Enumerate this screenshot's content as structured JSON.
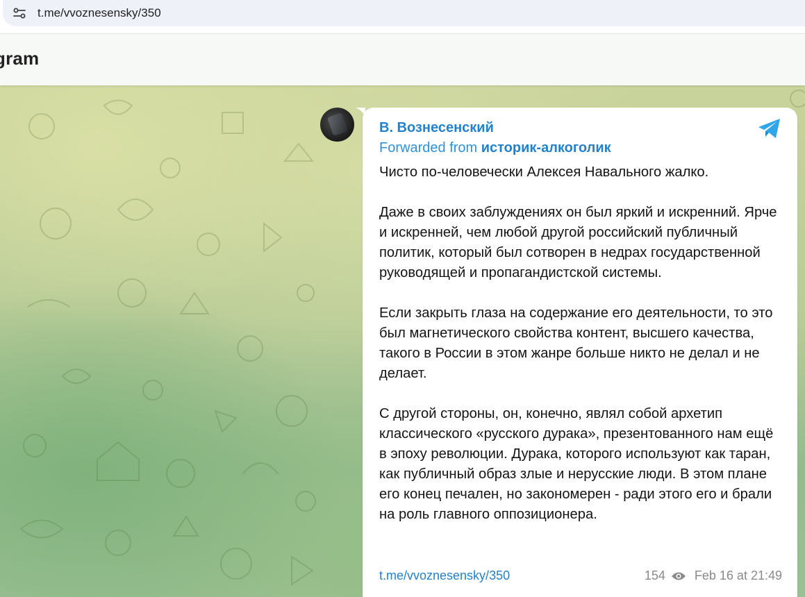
{
  "browser": {
    "url": "t.me/vvoznesensky/350"
  },
  "header": {
    "title": "gram"
  },
  "message": {
    "author": "В. Вознесенский",
    "forwarded_prefix": "Forwarded from ",
    "forwarded_source": "историк-алкоголик",
    "paragraphs": [
      "Чисто по-человечески Алексея Навального жалко.",
      "Даже в своих заблуждениях он был яркий и искренний. Ярче и искренней, чем любой другой российский публичный политик, который был сотворен в недрах государственной руководящей и пропагандистской системы.",
      "Если закрыть глаза на содержание его деятельности, то это был магнетического свойства контент, высшего качества, такого в России в этом жанре больше никто не делал и не делает.",
      "С другой стороны, он, конечно, являл собой архетип классического «русского дурака», презентованного нам ещё в эпоху революции. Дурака, которого используют как таран, как публичный образ злые и нерусские люди. В этом плане его конец печален, но закономерен - ради этого его и брали на роль главного оппозиционера."
    ],
    "link": "t.me/vvoznesensky/350",
    "views": "154",
    "timestamp": "Feb 16 at 21:49"
  },
  "colors": {
    "accent": "#2481cc",
    "bubble": "#ffffff",
    "meta": "#8a8a8a"
  },
  "icons": {
    "site_settings": "tune-icon",
    "send": "telegram-send-icon",
    "views": "eye-icon"
  }
}
